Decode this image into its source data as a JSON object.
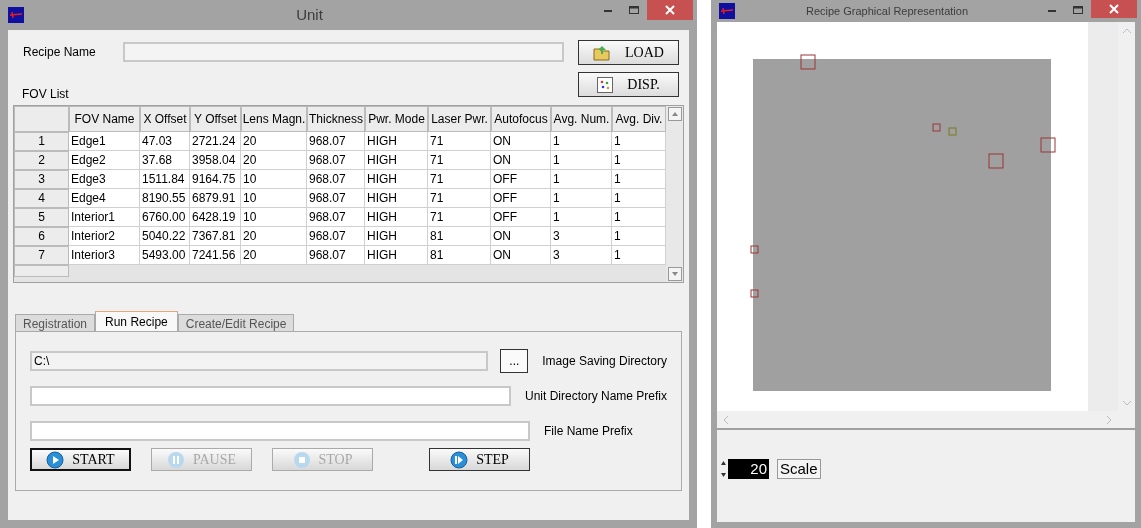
{
  "unit_window": {
    "title": "Unit",
    "recipe_name": {
      "label": "Recipe Name"
    },
    "buttons": [
      {
        "label": "LOAD",
        "kind": "load"
      },
      {
        "label": "DISP.",
        "kind": "disp"
      }
    ],
    "fov_list": {
      "label": "FOV List",
      "columns": [
        "FOV Name",
        "X Offset",
        "Y Offset",
        "Lens Magn.",
        "Thickness",
        "Pwr. Mode",
        "Laser Pwr.",
        "Autofocus",
        "Avg. Num.",
        "Avg. Div."
      ],
      "rows": [
        {
          "header": "1",
          "cells": [
            "Edge1",
            "47.03",
            "2721.24",
            "20",
            "968.07",
            "HIGH",
            "71",
            "ON",
            "1",
            "1"
          ]
        },
        {
          "header": "2",
          "cells": [
            "Edge2",
            "37.68",
            "3958.04",
            "20",
            "968.07",
            "HIGH",
            "71",
            "ON",
            "1",
            "1"
          ]
        },
        {
          "header": "3",
          "cells": [
            "Edge3",
            "1511.84",
            "9164.75",
            "10",
            "968.07",
            "HIGH",
            "71",
            "OFF",
            "1",
            "1"
          ]
        },
        {
          "header": "4",
          "cells": [
            "Edge4",
            "8190.55",
            "6879.91",
            "10",
            "968.07",
            "HIGH",
            "71",
            "OFF",
            "1",
            "1"
          ]
        },
        {
          "header": "5",
          "cells": [
            "Interior1",
            "6760.00",
            "6428.19",
            "10",
            "968.07",
            "HIGH",
            "71",
            "OFF",
            "1",
            "1"
          ]
        },
        {
          "header": "6",
          "cells": [
            "Interior2",
            "5040.22",
            "7367.81",
            "20",
            "968.07",
            "HIGH",
            "81",
            "ON",
            "3",
            "1"
          ]
        },
        {
          "header": "7",
          "cells": [
            "Interior3",
            "5493.00",
            "7241.56",
            "20",
            "968.07",
            "HIGH",
            "81",
            "ON",
            "3",
            "1"
          ]
        }
      ]
    },
    "tabs": [
      {
        "label": "Registration",
        "selected": false
      },
      {
        "label": "Run Recipe",
        "selected": true
      },
      {
        "label": "Create/Edit Recipe",
        "selected": false
      }
    ],
    "run_recipe": {
      "fields": [
        {
          "value": "C:\\",
          "label": "Image Saving Directory",
          "browse": "..."
        },
        {
          "label": "Unit Directory Name Prefix"
        },
        {
          "label": "File Name Prefix"
        }
      ],
      "buttons": [
        {
          "label": "START",
          "kind": "play",
          "default": true,
          "disabled": false
        },
        {
          "label": "PAUSE",
          "kind": "pause",
          "default": false,
          "disabled": true
        },
        {
          "label": "STOP",
          "kind": "stop",
          "default": false,
          "disabled": true
        },
        {
          "label": "STEP",
          "kind": "step",
          "default": false,
          "disabled": false
        }
      ]
    }
  },
  "graph_window": {
    "title": "Recipe Graphical Representation",
    "scale": {
      "value": "20",
      "button": "Scale"
    }
  }
}
